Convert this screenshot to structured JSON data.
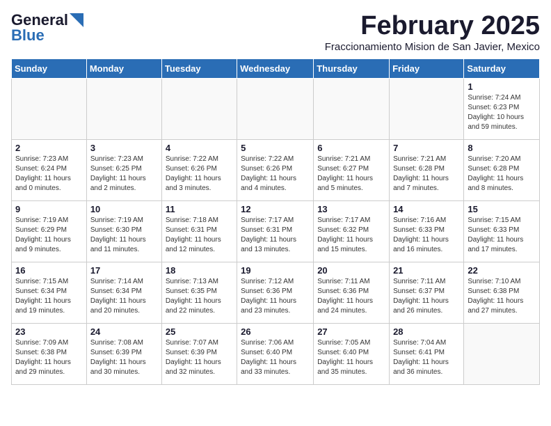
{
  "header": {
    "logo_line1": "General",
    "logo_line2": "Blue",
    "title": "February 2025",
    "subtitle": "Fraccionamiento Mision de San Javier, Mexico"
  },
  "days_of_week": [
    "Sunday",
    "Monday",
    "Tuesday",
    "Wednesday",
    "Thursday",
    "Friday",
    "Saturday"
  ],
  "weeks": [
    [
      {
        "day": "",
        "info": ""
      },
      {
        "day": "",
        "info": ""
      },
      {
        "day": "",
        "info": ""
      },
      {
        "day": "",
        "info": ""
      },
      {
        "day": "",
        "info": ""
      },
      {
        "day": "",
        "info": ""
      },
      {
        "day": "1",
        "info": "Sunrise: 7:24 AM\nSunset: 6:23 PM\nDaylight: 10 hours\nand 59 minutes."
      }
    ],
    [
      {
        "day": "2",
        "info": "Sunrise: 7:23 AM\nSunset: 6:24 PM\nDaylight: 11 hours\nand 0 minutes."
      },
      {
        "day": "3",
        "info": "Sunrise: 7:23 AM\nSunset: 6:25 PM\nDaylight: 11 hours\nand 2 minutes."
      },
      {
        "day": "4",
        "info": "Sunrise: 7:22 AM\nSunset: 6:26 PM\nDaylight: 11 hours\nand 3 minutes."
      },
      {
        "day": "5",
        "info": "Sunrise: 7:22 AM\nSunset: 6:26 PM\nDaylight: 11 hours\nand 4 minutes."
      },
      {
        "day": "6",
        "info": "Sunrise: 7:21 AM\nSunset: 6:27 PM\nDaylight: 11 hours\nand 5 minutes."
      },
      {
        "day": "7",
        "info": "Sunrise: 7:21 AM\nSunset: 6:28 PM\nDaylight: 11 hours\nand 7 minutes."
      },
      {
        "day": "8",
        "info": "Sunrise: 7:20 AM\nSunset: 6:28 PM\nDaylight: 11 hours\nand 8 minutes."
      }
    ],
    [
      {
        "day": "9",
        "info": "Sunrise: 7:19 AM\nSunset: 6:29 PM\nDaylight: 11 hours\nand 9 minutes."
      },
      {
        "day": "10",
        "info": "Sunrise: 7:19 AM\nSunset: 6:30 PM\nDaylight: 11 hours\nand 11 minutes."
      },
      {
        "day": "11",
        "info": "Sunrise: 7:18 AM\nSunset: 6:31 PM\nDaylight: 11 hours\nand 12 minutes."
      },
      {
        "day": "12",
        "info": "Sunrise: 7:17 AM\nSunset: 6:31 PM\nDaylight: 11 hours\nand 13 minutes."
      },
      {
        "day": "13",
        "info": "Sunrise: 7:17 AM\nSunset: 6:32 PM\nDaylight: 11 hours\nand 15 minutes."
      },
      {
        "day": "14",
        "info": "Sunrise: 7:16 AM\nSunset: 6:33 PM\nDaylight: 11 hours\nand 16 minutes."
      },
      {
        "day": "15",
        "info": "Sunrise: 7:15 AM\nSunset: 6:33 PM\nDaylight: 11 hours\nand 17 minutes."
      }
    ],
    [
      {
        "day": "16",
        "info": "Sunrise: 7:15 AM\nSunset: 6:34 PM\nDaylight: 11 hours\nand 19 minutes."
      },
      {
        "day": "17",
        "info": "Sunrise: 7:14 AM\nSunset: 6:34 PM\nDaylight: 11 hours\nand 20 minutes."
      },
      {
        "day": "18",
        "info": "Sunrise: 7:13 AM\nSunset: 6:35 PM\nDaylight: 11 hours\nand 22 minutes."
      },
      {
        "day": "19",
        "info": "Sunrise: 7:12 AM\nSunset: 6:36 PM\nDaylight: 11 hours\nand 23 minutes."
      },
      {
        "day": "20",
        "info": "Sunrise: 7:11 AM\nSunset: 6:36 PM\nDaylight: 11 hours\nand 24 minutes."
      },
      {
        "day": "21",
        "info": "Sunrise: 7:11 AM\nSunset: 6:37 PM\nDaylight: 11 hours\nand 26 minutes."
      },
      {
        "day": "22",
        "info": "Sunrise: 7:10 AM\nSunset: 6:38 PM\nDaylight: 11 hours\nand 27 minutes."
      }
    ],
    [
      {
        "day": "23",
        "info": "Sunrise: 7:09 AM\nSunset: 6:38 PM\nDaylight: 11 hours\nand 29 minutes."
      },
      {
        "day": "24",
        "info": "Sunrise: 7:08 AM\nSunset: 6:39 PM\nDaylight: 11 hours\nand 30 minutes."
      },
      {
        "day": "25",
        "info": "Sunrise: 7:07 AM\nSunset: 6:39 PM\nDaylight: 11 hours\nand 32 minutes."
      },
      {
        "day": "26",
        "info": "Sunrise: 7:06 AM\nSunset: 6:40 PM\nDaylight: 11 hours\nand 33 minutes."
      },
      {
        "day": "27",
        "info": "Sunrise: 7:05 AM\nSunset: 6:40 PM\nDaylight: 11 hours\nand 35 minutes."
      },
      {
        "day": "28",
        "info": "Sunrise: 7:04 AM\nSunset: 6:41 PM\nDaylight: 11 hours\nand 36 minutes."
      },
      {
        "day": "",
        "info": ""
      }
    ]
  ]
}
